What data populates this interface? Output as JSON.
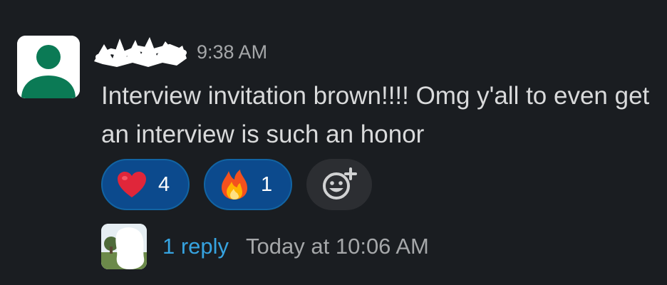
{
  "message": {
    "timestamp": "9:38 AM",
    "text": "Interview invitation brown!!!! Omg y'all to even get an interview is such an honor",
    "author_avatar_icon": "default-user-icon"
  },
  "reactions": [
    {
      "emoji": "heart-icon",
      "count": "4"
    },
    {
      "emoji": "fire-icon",
      "count": "1"
    }
  ],
  "add_reaction_icon": "add-reaction-icon",
  "thread": {
    "reply_count": "1 reply",
    "last_reply": "Today at 10:06 AM"
  },
  "colors": {
    "background": "#1a1d21",
    "reaction_selected": "#0c4a8d",
    "link": "#36a3e0",
    "avatar_green": "#0b7a55"
  }
}
